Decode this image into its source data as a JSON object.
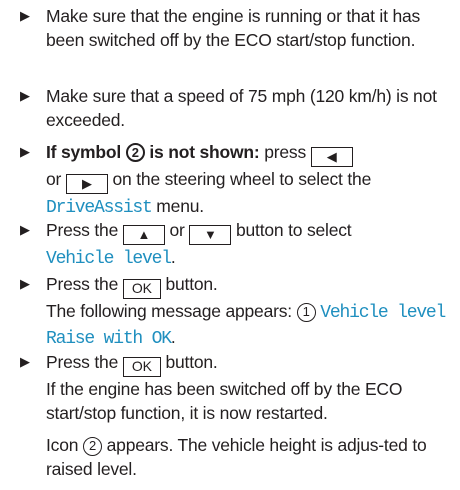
{
  "steps": [
    {
      "text": "Make sure that the engine is running or that it has been switched off by the ECO start/stop function."
    },
    {
      "text": "Make sure that a speed of 75 mph (120 km/h) is not exceeded."
    },
    {
      "bold_lead": "If symbol",
      "circle": "2",
      "bold_tail": "is not shown:",
      "t1": "press",
      "key_left": "◀",
      "t2": "or",
      "key_right": "▶",
      "t3": "on the steering wheel to select the",
      "menu": "DriveAssist",
      "t4": "menu."
    },
    {
      "t1": "Press the",
      "key_up": "▲",
      "t2": "or",
      "key_down": "▼",
      "t3": "button to select",
      "menu": "Vehicle level",
      "t4": "."
    },
    {
      "t1": "Press the",
      "key_ok": "OK",
      "t2": "button.",
      "t3": "The following message appears:",
      "circle": "1",
      "msg": "Vehicle level Raise with OK",
      "t4": "."
    },
    {
      "t1": "Press the",
      "key_ok": "OK",
      "t2": "button.",
      "t3": "If the engine has been switched off by the ECO start/stop function, it is now restarted.",
      "p2a": "Icon",
      "circle": "2",
      "p2b": "appears. The vehicle height is adjus-ted to raised level."
    }
  ],
  "icons": {
    "bullet": "play-arrow-icon"
  }
}
